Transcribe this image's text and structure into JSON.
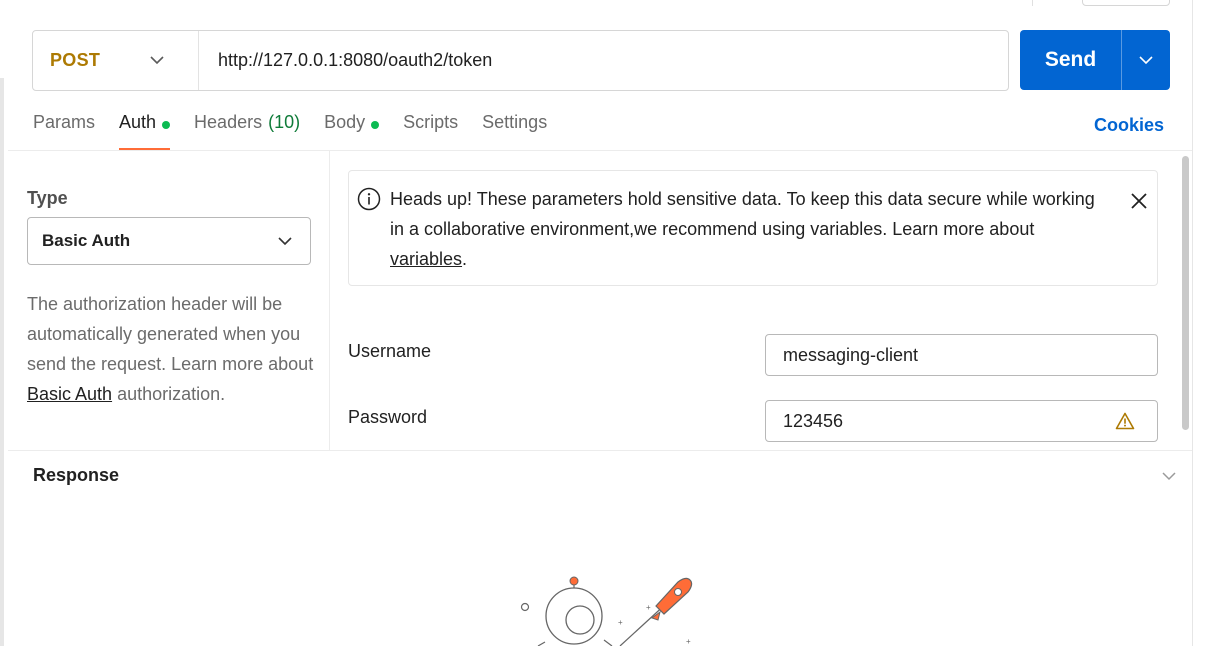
{
  "request": {
    "method": "POST",
    "url": "http://127.0.0.1:8080/oauth2/token",
    "send_label": "Send"
  },
  "tabs": [
    {
      "label": "Params"
    },
    {
      "label": "Auth"
    },
    {
      "label": "Headers",
      "count": "(10)"
    },
    {
      "label": "Body"
    },
    {
      "label": "Scripts"
    },
    {
      "label": "Settings"
    }
  ],
  "cookies_label": "Cookies",
  "auth": {
    "type_label": "Type",
    "type_value": "Basic Auth",
    "description_before": "The authorization header will be automatically generated when you send the request. Learn more about",
    "description_link": "Basic Auth",
    "description_after": "authorization."
  },
  "notice": {
    "text": "Heads up! These parameters hold sensitive data. To keep this data secure while working in a collaborative environment,we recommend using variables. Learn more about",
    "link": "variables",
    "end": "."
  },
  "fields": {
    "username_label": "Username",
    "username_value": "messaging-client",
    "password_label": "Password",
    "password_value": "123456"
  },
  "response": {
    "title": "Response"
  },
  "colors": {
    "method": "#ad7a03",
    "send": "#0265d2",
    "active_tab_underline": "#ff6c37",
    "status_dot": "#0cbb52",
    "cookies": "#0265d2"
  }
}
